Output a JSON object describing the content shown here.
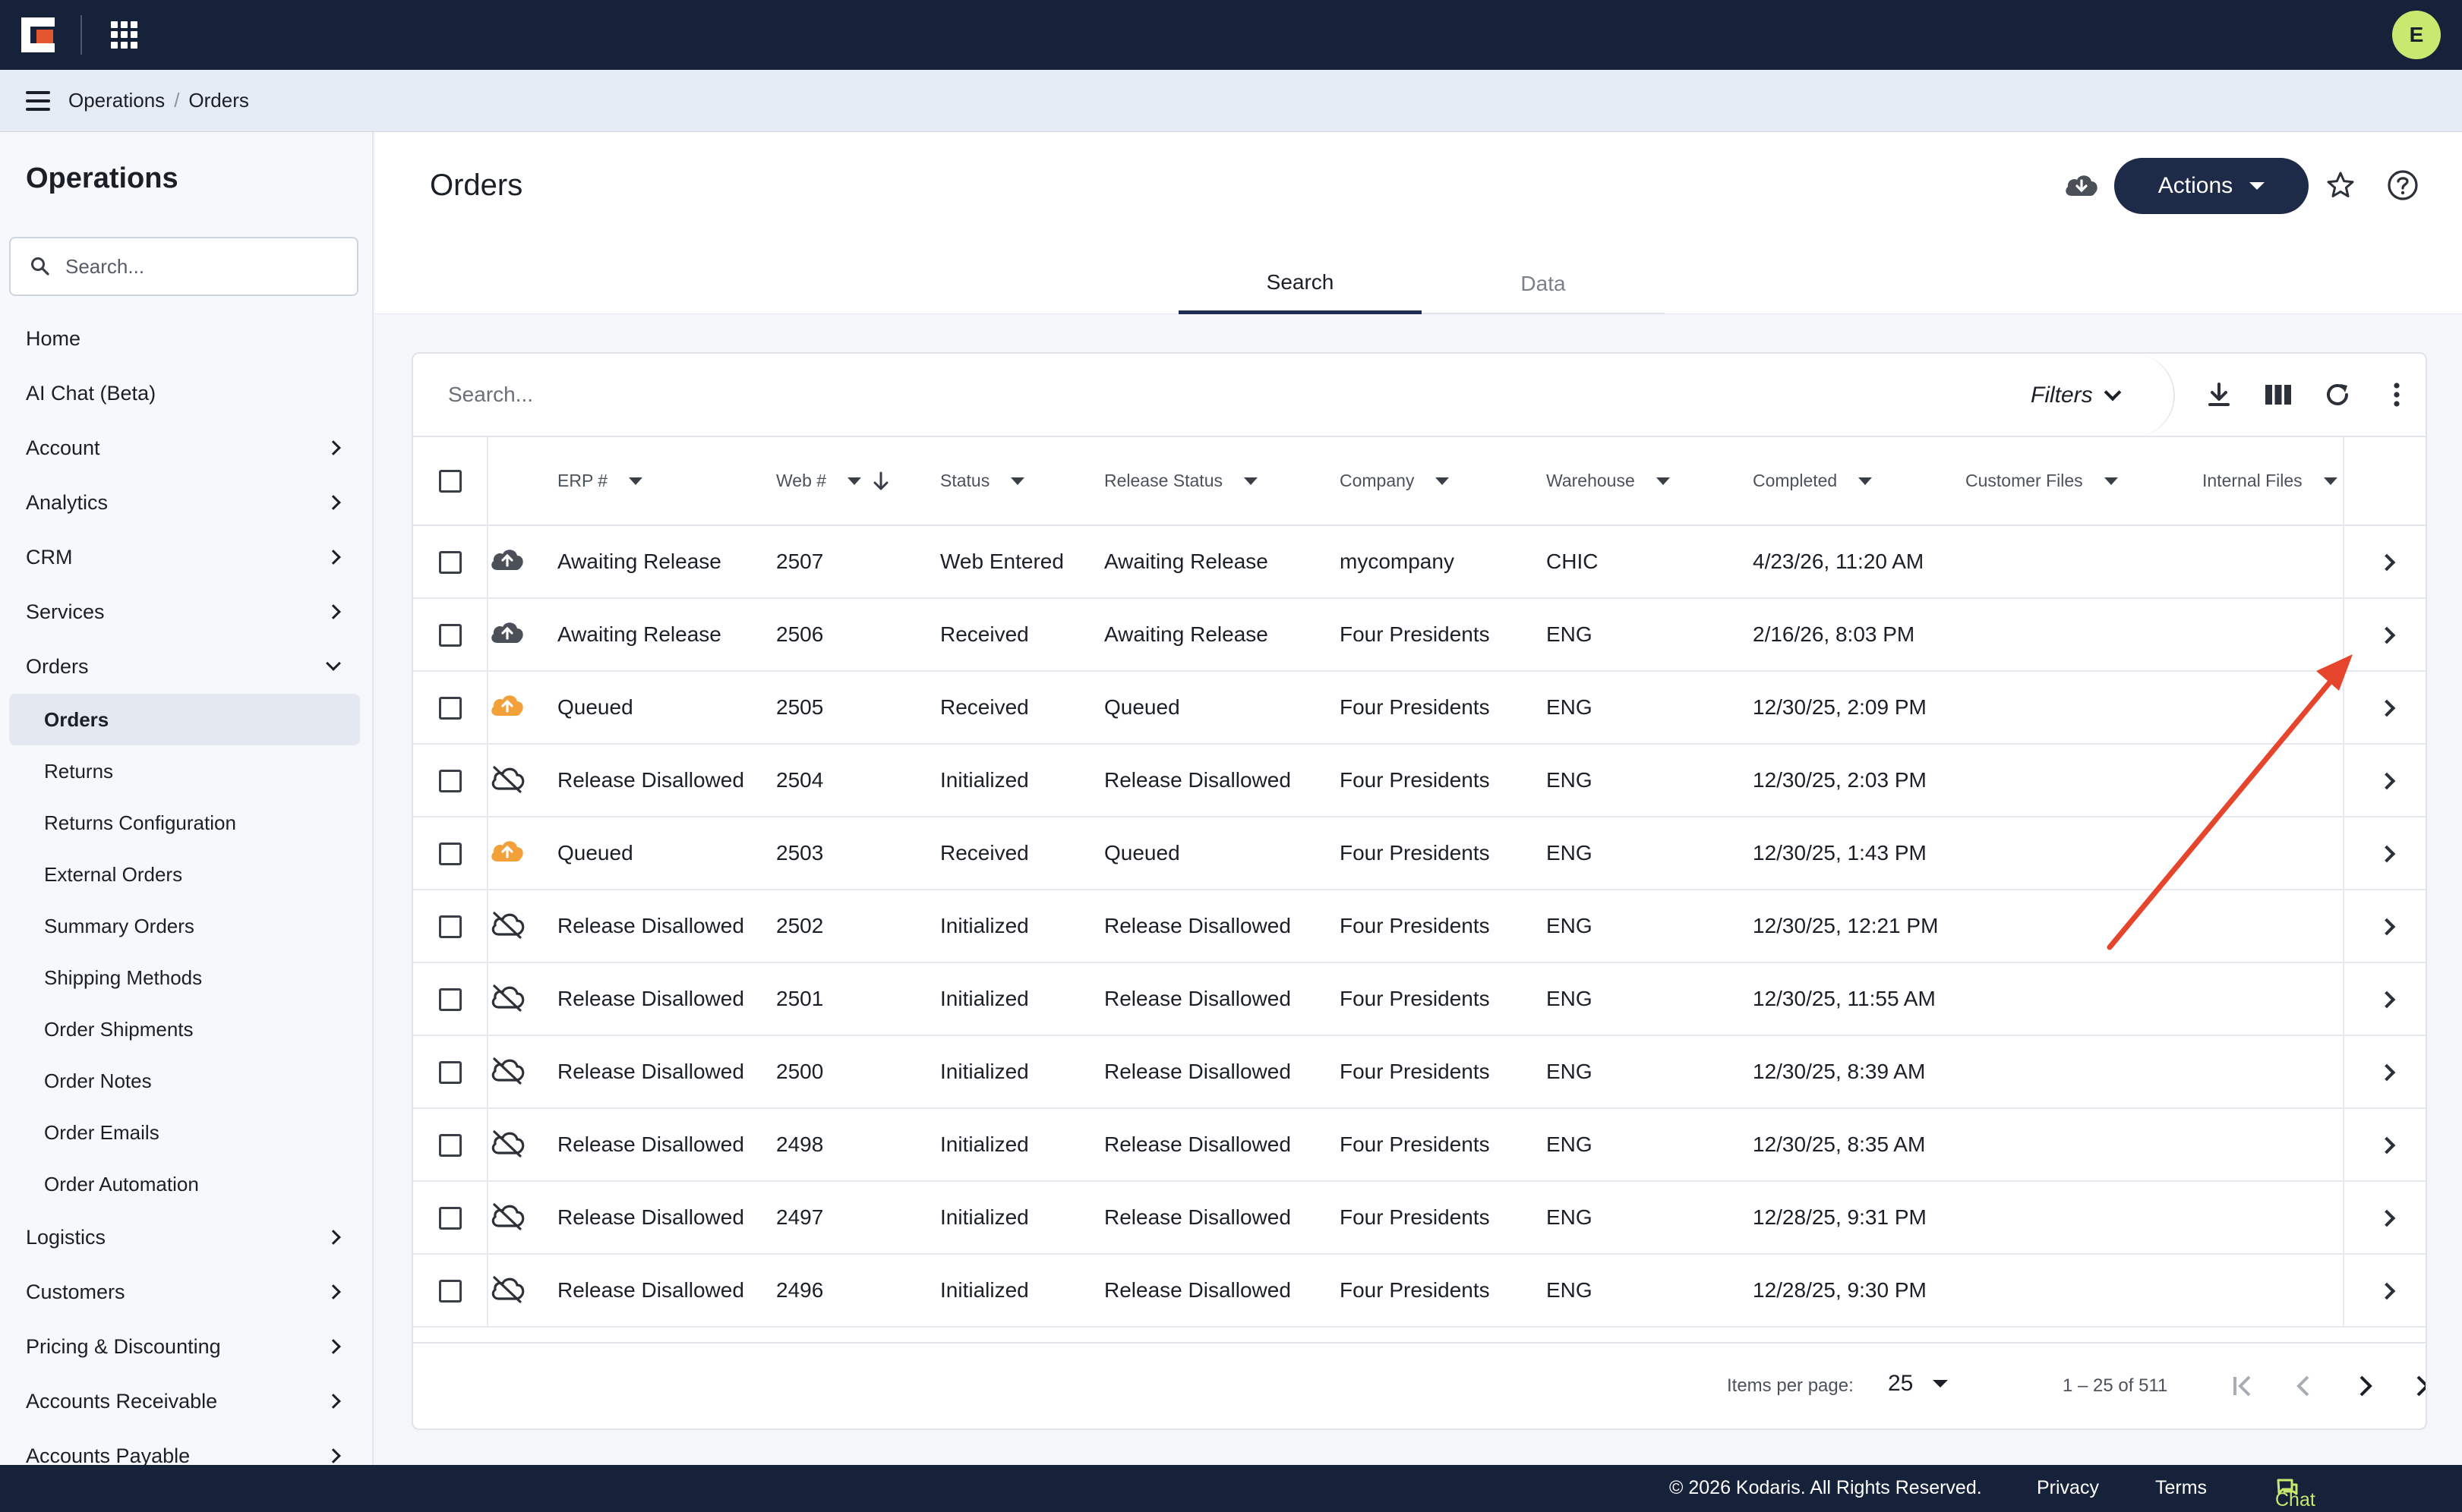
{
  "topbar": {
    "avatar_letter": "E"
  },
  "breadcrumb": {
    "items": [
      "Operations",
      "Orders"
    ],
    "separator": "/"
  },
  "sidebar": {
    "title": "Operations",
    "search_placeholder": "Search...",
    "items": [
      {
        "label": "Home",
        "chevron": "none"
      },
      {
        "label": "AI Chat (Beta)",
        "chevron": "none"
      },
      {
        "label": "Account",
        "chevron": "right"
      },
      {
        "label": "Analytics",
        "chevron": "right"
      },
      {
        "label": "CRM",
        "chevron": "right"
      },
      {
        "label": "Services",
        "chevron": "right"
      },
      {
        "label": "Orders",
        "chevron": "down"
      }
    ],
    "sub_items": [
      {
        "label": "Orders",
        "active": true
      },
      {
        "label": "Returns"
      },
      {
        "label": "Returns Configuration"
      },
      {
        "label": "External Orders"
      },
      {
        "label": "Summary Orders"
      },
      {
        "label": "Shipping Methods"
      },
      {
        "label": "Order Shipments"
      },
      {
        "label": "Order Notes"
      },
      {
        "label": "Order Emails"
      },
      {
        "label": "Order Automation"
      }
    ],
    "items_after": [
      {
        "label": "Logistics"
      },
      {
        "label": "Customers"
      },
      {
        "label": "Pricing & Discounting"
      },
      {
        "label": "Accounts Receivable"
      },
      {
        "label": "Accounts Payable"
      }
    ]
  },
  "main": {
    "title": "Orders",
    "actions_label": "Actions",
    "tabs": [
      "Search",
      "Data"
    ],
    "active_tab": "Search"
  },
  "toolbar": {
    "search_placeholder": "Search...",
    "filters_label": "Filters"
  },
  "table": {
    "columns": [
      "ERP #",
      "Web #",
      "Status",
      "Release Status",
      "Company",
      "Warehouse",
      "Completed",
      "Customer Files",
      "Internal Files"
    ],
    "rows": [
      {
        "icon": "cloud-upload-icon",
        "erp": "Awaiting Release",
        "web": "2507",
        "status": "Web Entered",
        "release": "Awaiting Release",
        "company": "mycompany",
        "warehouse": "CHIC",
        "completed": "4/23/26, 11:20 AM"
      },
      {
        "icon": "cloud-upload-icon",
        "erp": "Awaiting Release",
        "web": "2506",
        "status": "Received",
        "release": "Awaiting Release",
        "company": "Four Presidents",
        "warehouse": "ENG",
        "completed": "2/16/26, 8:03 PM"
      },
      {
        "icon": "cloud-queued-icon",
        "erp": "Queued",
        "web": "2505",
        "status": "Received",
        "release": "Queued",
        "company": "Four Presidents",
        "warehouse": "ENG",
        "completed": "12/30/25, 2:09 PM"
      },
      {
        "icon": "cloud-off-icon",
        "erp": "Release Disallowed",
        "web": "2504",
        "status": "Initialized",
        "release": "Release Disallowed",
        "company": "Four Presidents",
        "warehouse": "ENG",
        "completed": "12/30/25, 2:03 PM"
      },
      {
        "icon": "cloud-queued-icon",
        "erp": "Queued",
        "web": "2503",
        "status": "Received",
        "release": "Queued",
        "company": "Four Presidents",
        "warehouse": "ENG",
        "completed": "12/30/25, 1:43 PM"
      },
      {
        "icon": "cloud-off-icon",
        "erp": "Release Disallowed",
        "web": "2502",
        "status": "Initialized",
        "release": "Release Disallowed",
        "company": "Four Presidents",
        "warehouse": "ENG",
        "completed": "12/30/25, 12:21 PM"
      },
      {
        "icon": "cloud-off-icon",
        "erp": "Release Disallowed",
        "web": "2501",
        "status": "Initialized",
        "release": "Release Disallowed",
        "company": "Four Presidents",
        "warehouse": "ENG",
        "completed": "12/30/25, 11:55 AM"
      },
      {
        "icon": "cloud-off-icon",
        "erp": "Release Disallowed",
        "web": "2500",
        "status": "Initialized",
        "release": "Release Disallowed",
        "company": "Four Presidents",
        "warehouse": "ENG",
        "completed": "12/30/25, 8:39 AM"
      },
      {
        "icon": "cloud-off-icon",
        "erp": "Release Disallowed",
        "web": "2498",
        "status": "Initialized",
        "release": "Release Disallowed",
        "company": "Four Presidents",
        "warehouse": "ENG",
        "completed": "12/30/25, 8:35 AM"
      },
      {
        "icon": "cloud-off-icon",
        "erp": "Release Disallowed",
        "web": "2497",
        "status": "Initialized",
        "release": "Release Disallowed",
        "company": "Four Presidents",
        "warehouse": "ENG",
        "completed": "12/28/25, 9:31 PM"
      },
      {
        "icon": "cloud-off-icon",
        "erp": "Release Disallowed",
        "web": "2496",
        "status": "Initialized",
        "release": "Release Disallowed",
        "company": "Four Presidents",
        "warehouse": "ENG",
        "completed": "12/28/25, 9:30 PM"
      }
    ]
  },
  "pagination": {
    "items_per_page_label": "Items per page:",
    "items_per_page": "25",
    "range": "1 – 25 of 511"
  },
  "footer": {
    "copyright": "© 2026 Kodaris. All Rights Reserved.",
    "privacy": "Privacy",
    "terms": "Terms",
    "chat": "Chat with us"
  },
  "colors": {
    "navy": "#16213a",
    "accent_arrow": "#e6452d",
    "queued": "#f2a13a",
    "avatar": "#c9e86f"
  }
}
